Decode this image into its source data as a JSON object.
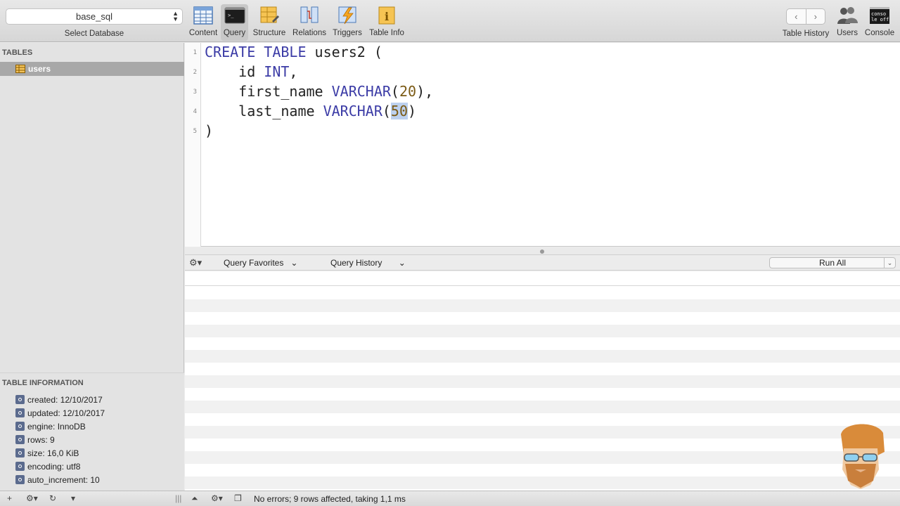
{
  "toolbar": {
    "database": "base_sql",
    "database_label": "Select Database",
    "buttons": [
      {
        "label": "Content"
      },
      {
        "label": "Query"
      },
      {
        "label": "Structure"
      },
      {
        "label": "Relations"
      },
      {
        "label": "Triggers"
      },
      {
        "label": "Table Info"
      }
    ],
    "right_buttons": {
      "history": "Table History",
      "users": "Users",
      "console": "Console"
    },
    "nav_back": "‹",
    "nav_forward": "›"
  },
  "sidebar": {
    "tables_title": "TABLES",
    "tables": [
      {
        "name": "users"
      }
    ],
    "info_title": "TABLE INFORMATION",
    "info": [
      "created: 12/10/2017",
      "updated: 12/10/2017",
      "engine: InnoDB",
      "rows: 9",
      "size: 16,0 KiB",
      "encoding: utf8",
      "auto_increment: 10"
    ]
  },
  "editor": {
    "line_numbers": [
      "1",
      "2",
      "3",
      "4",
      "5"
    ],
    "lines": [
      [
        {
          "t": "CREATE TABLE",
          "c": "kw"
        },
        {
          "t": " users2 (",
          "c": ""
        }
      ],
      [
        {
          "t": "    id ",
          "c": ""
        },
        {
          "t": "INT",
          "c": "kw"
        },
        {
          "t": ",",
          "c": ""
        }
      ],
      [
        {
          "t": "    first_name ",
          "c": ""
        },
        {
          "t": "VARCHAR",
          "c": "kw"
        },
        {
          "t": "(",
          "c": ""
        },
        {
          "t": "20",
          "c": "num"
        },
        {
          "t": "),",
          "c": ""
        }
      ],
      [
        {
          "t": "    last_name ",
          "c": ""
        },
        {
          "t": "VARCHAR",
          "c": "kw"
        },
        {
          "t": "(",
          "c": ""
        },
        {
          "t": "50",
          "c": "num sel"
        },
        {
          "t": ")",
          "c": ""
        }
      ],
      [
        {
          "t": ")",
          "c": ""
        }
      ]
    ]
  },
  "querybar": {
    "favorites": "Query Favorites",
    "history": "Query History",
    "run": "Run All"
  },
  "status": {
    "message": "No errors; 9 rows affected, taking 1,1 ms"
  },
  "colors": {
    "keyword": "#3c3ca6",
    "number": "#7b5a14",
    "selection": "#bdd1ef"
  }
}
